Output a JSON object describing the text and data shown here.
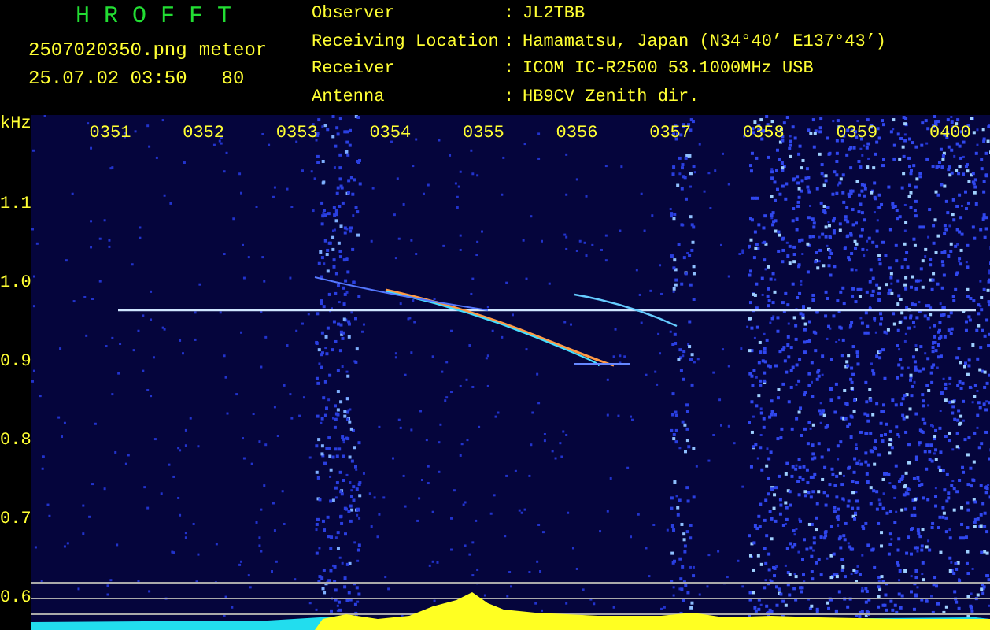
{
  "app_title": "HROFFT",
  "file_name": "2507020350.png",
  "timestamp": "25.07.02 03:50",
  "mode": "meteor",
  "count": "80",
  "station": [
    {
      "label": "Observer",
      "sep": ":",
      "value": "JL2TBB"
    },
    {
      "label": "Receiving Location",
      "sep": ":",
      "value": "Hamamatsu, Japan (N34°40’ E137°43’)"
    },
    {
      "label": "Receiver",
      "sep": ":",
      "value": "ICOM IC-R2500 53.1000MHz USB"
    },
    {
      "label": "Antenna",
      "sep": ":",
      "value": "HB9CV Zenith dir."
    }
  ],
  "plot": {
    "unit": "kHz",
    "time_labels": [
      "0351",
      "0352",
      "0353",
      "0354",
      "0355",
      "0356",
      "0357",
      "0358",
      "0359",
      "0400"
    ],
    "freq_labels": [
      "1.1",
      "1.0",
      "0.9",
      "0.8",
      "0.7",
      "0.6"
    ]
  }
}
